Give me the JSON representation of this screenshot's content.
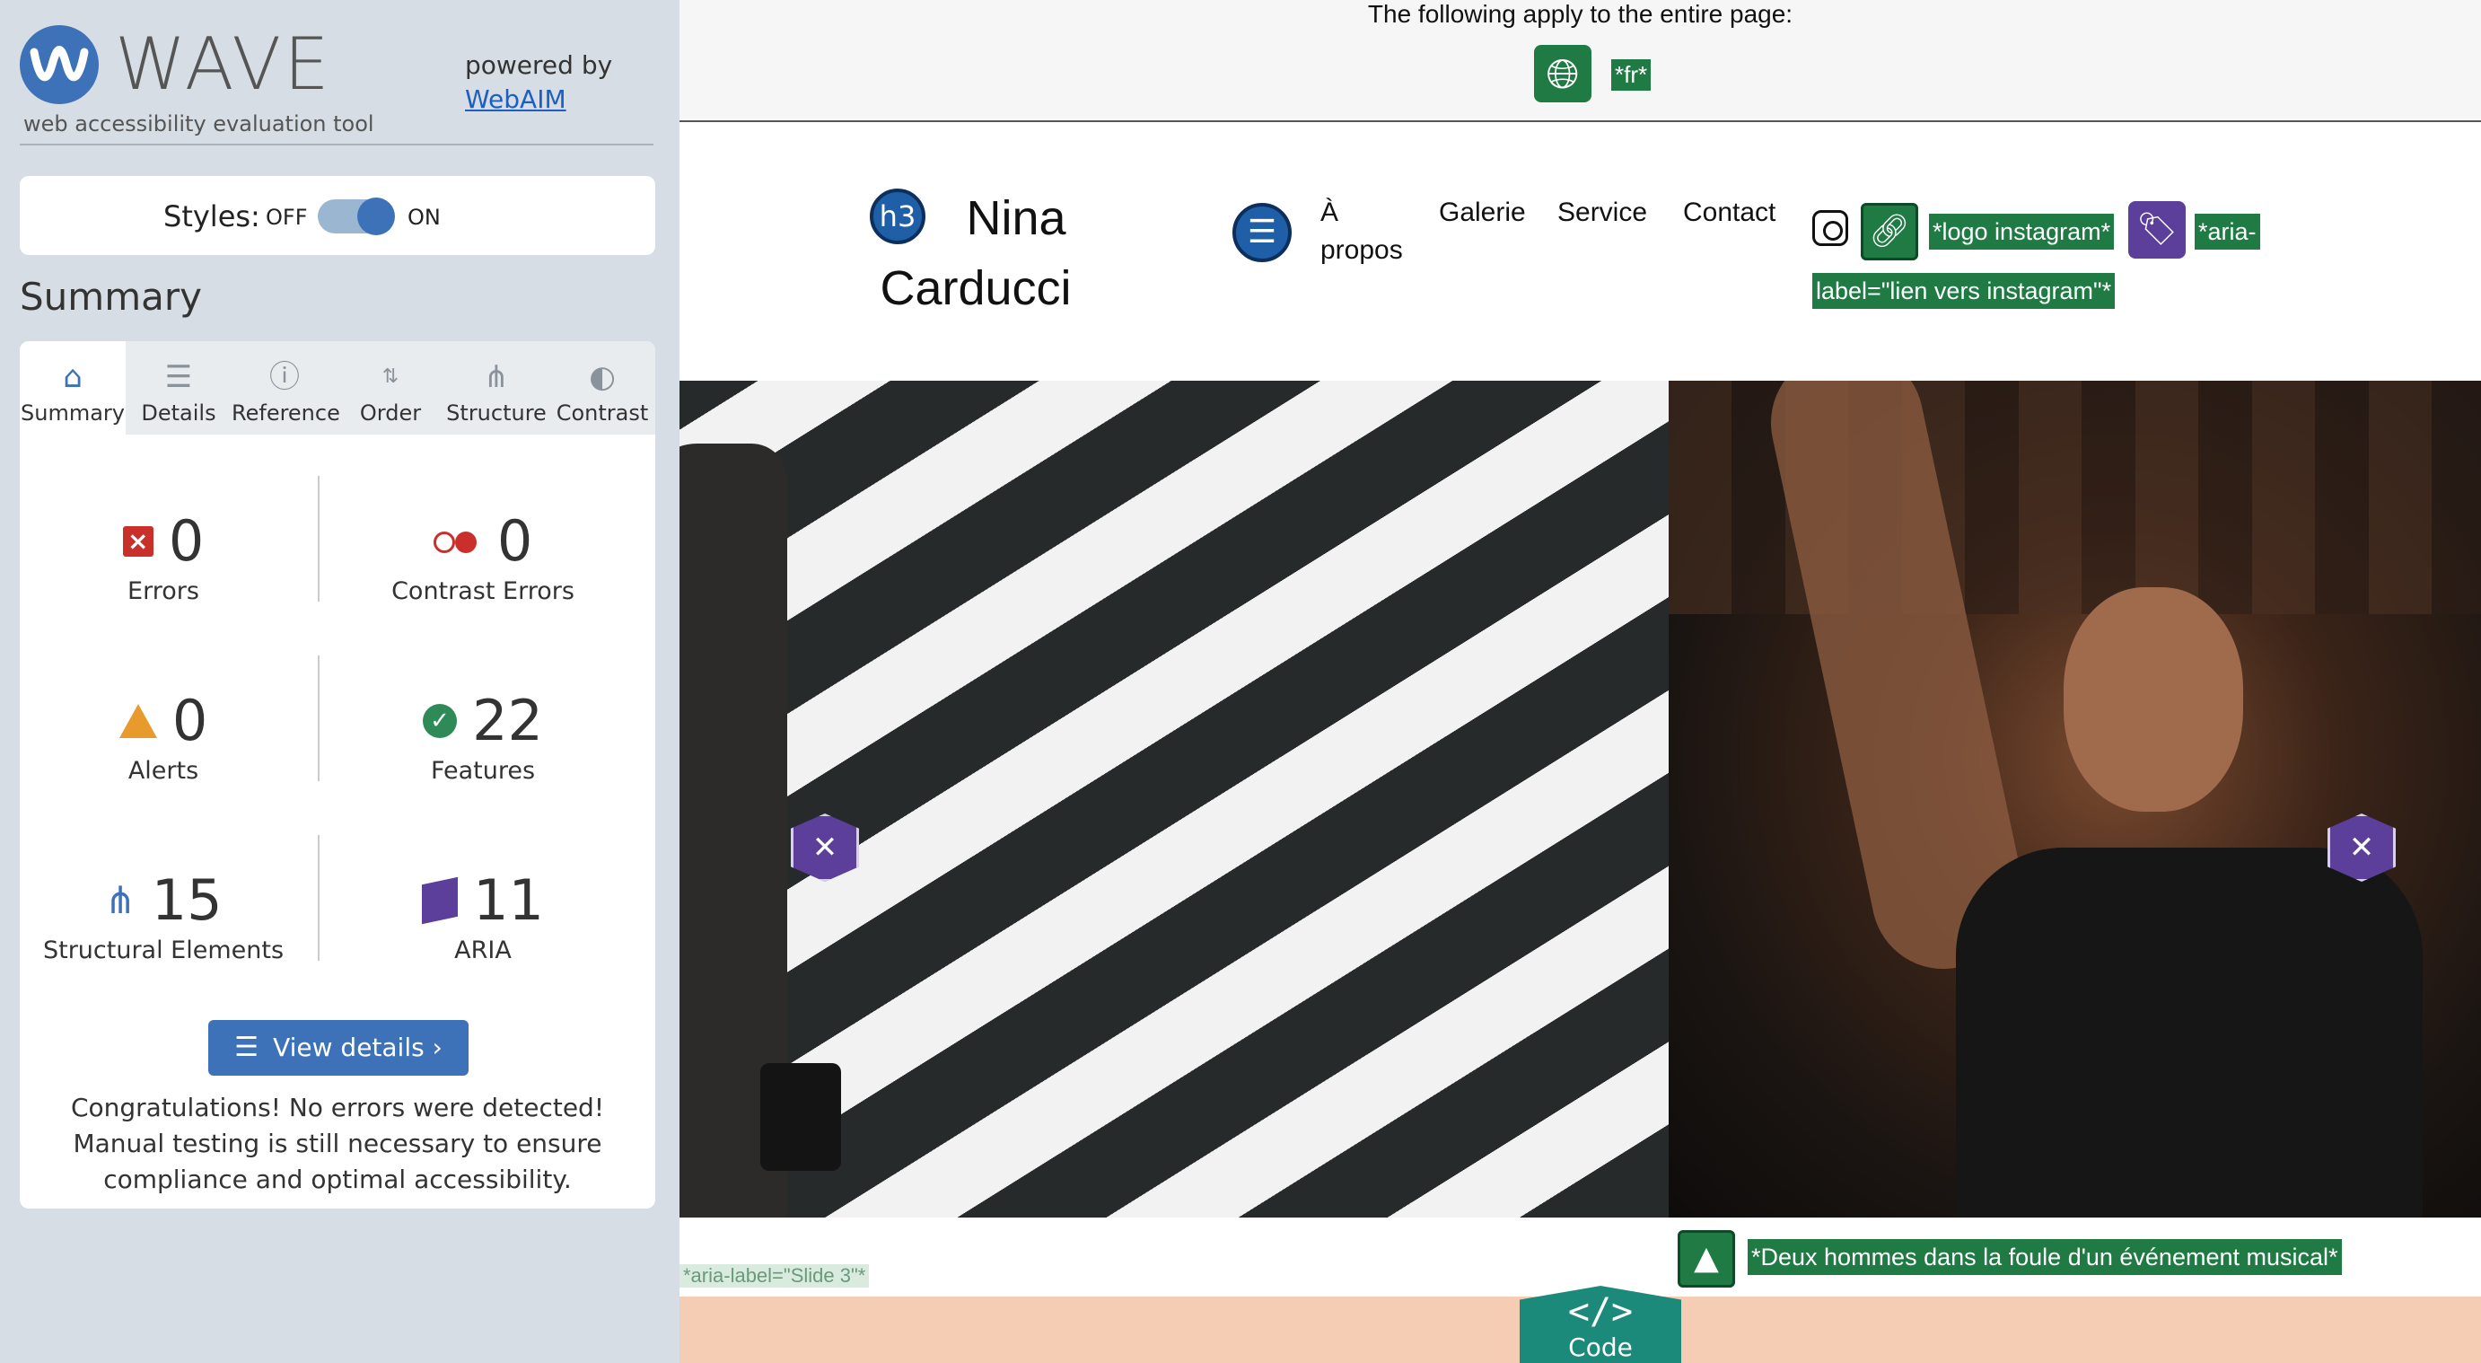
{
  "wave": {
    "logo_word": "WAVE",
    "logo_subtitle": "web accessibility evaluation tool",
    "powered_by": "powered by",
    "webaim_link": "WebAIM",
    "styles_label": "Styles:",
    "styles_off": "OFF",
    "styles_on": "ON",
    "summary_heading": "Summary",
    "tabs": [
      {
        "label": "Summary",
        "icon": "home-icon"
      },
      {
        "label": "Details",
        "icon": "list-icon"
      },
      {
        "label": "Reference",
        "icon": "info-icon"
      },
      {
        "label": "Order",
        "icon": "order-icon"
      },
      {
        "label": "Structure",
        "icon": "structure-icon"
      },
      {
        "label": "Contrast",
        "icon": "contrast-icon"
      }
    ],
    "stats": {
      "errors": {
        "count": "0",
        "label": "Errors"
      },
      "contrast_errors": {
        "count": "0",
        "label": "Contrast Errors"
      },
      "alerts": {
        "count": "0",
        "label": "Alerts"
      },
      "features": {
        "count": "22",
        "label": "Features"
      },
      "structural": {
        "count": "15",
        "label": "Structural Elements"
      },
      "aria": {
        "count": "11",
        "label": "ARIA"
      }
    },
    "view_details": "View details ›",
    "congrats": "Congratulations! No errors were detected! Manual testing is still necessary to ensure compliance and optimal accessibility."
  },
  "site": {
    "page_bar_text": "The following apply to the entire page:",
    "lang_tag": "*fr*",
    "h3_badge": "h3",
    "title_line1": "Nina",
    "title_line2": "Carducci",
    "nav": [
      "À propos",
      "Galerie",
      "Service",
      "Contact"
    ],
    "nav_apropos_1": "À",
    "nav_apropos_2": "propos",
    "insta_alt_tag": "*logo instagram*",
    "aria_label_tag_1": "*aria-",
    "aria_label_tag_2": "label=\"lien vers instagram\"*",
    "image_alt_tag": "*Deux hommes dans la foule d'un événement musical*",
    "slide_tag": "*aria-label=\"Slide 3\"*",
    "code_button": "Code",
    "code_symbol": "</>"
  },
  "colors": {
    "wave_blue": "#3d72b8",
    "feature_green": "#1f7a44",
    "aria_purple": "#5b3f9b",
    "error_red": "#c9302c",
    "alert_orange": "#e89a2c",
    "code_teal": "#1c8a7a"
  }
}
